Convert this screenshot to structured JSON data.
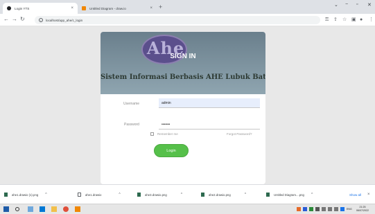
{
  "browser": {
    "tabs": [
      {
        "title": "Login YTS",
        "active": true
      },
      {
        "title": "Untitled Diagram - draw.io",
        "active": false
      }
    ],
    "url": "localhost/app_ahe/c_login"
  },
  "login_card": {
    "logo_text": "Ahe",
    "heading": "SIGN IN",
    "subtitle": "Sistem Informasi Berbasis AHE Lubuk Batang",
    "username_label": "Username",
    "username_value": "admin",
    "password_label": "Password",
    "password_value": "•••••••",
    "remember_label": "Remember me",
    "forgot_label": "Forgot Password?",
    "login_label": "Login",
    "accent": "#56c04a"
  },
  "downloads": {
    "items": [
      {
        "name": "ahe1.drawio (1).png",
        "icon": "image-file-icon"
      },
      {
        "name": "ahe1.drawio",
        "icon": "file-icon"
      },
      {
        "name": "ahe3.drawio.png",
        "icon": "image-file-icon"
      },
      {
        "name": "ahe2.drawio.png",
        "icon": "image-file-icon"
      },
      {
        "name": "Untitled Diagram....png",
        "icon": "image-file-icon"
      }
    ],
    "show_all": "Show all"
  },
  "taskbar": {
    "lang": "ENG",
    "time": "21:25",
    "date": "06/07/2022"
  }
}
